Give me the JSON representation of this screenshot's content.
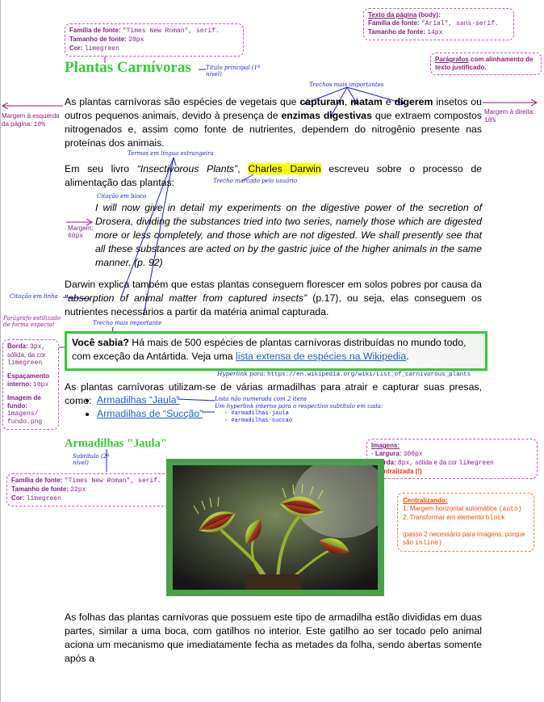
{
  "annotations": {
    "title_font": {
      "family_label": "Família de fonte:",
      "family_value": "\"Times New Roman\", serif.",
      "size_label": "Tamanho de fonte:",
      "size_value": "28px",
      "color_label": "Cor:",
      "color_value": "limegreen"
    },
    "page_text": {
      "heading": "Texto da página",
      "heading_suffix": "(body):",
      "family_label": "Família de fonte:",
      "family_value": "\"Arial\", sans-serif.",
      "size_label": "Tamanho de fonte:",
      "size_value": "14px"
    },
    "paragraphs": {
      "keyword": "Parágrafos",
      "text": "com alinhamento de texto justificado."
    },
    "margin_left": {
      "label": "Margem à esquerda da página:",
      "value": "10%"
    },
    "margin_right": {
      "label": "Margem à direita:",
      "value": "10%"
    },
    "title_main_hand": "Título principal (1º nível)",
    "important_hand": "Trechos mais importantes",
    "foreign_hand": "Termos em língua estrangeira",
    "user_marked_hand": "Trecho marcado pelo usuário",
    "blockquote_hand": "Citação em bloco",
    "margin_quote": {
      "label": "Margem:",
      "value": "60px"
    },
    "inline_quote_hand": "Citação em linha",
    "important_hand_2": "Trecho mais importante",
    "styled_para_hand": "Parágrafo estilizado de forma especial",
    "styled_box": {
      "border_label": "Borda:",
      "border_value": "3px,",
      "border_desc": "sólida, da cor",
      "border_color": "limegreen",
      "padding_label": "Espaçamento interno:",
      "padding_value": "10px",
      "bg_label": "Imagem de fundo:",
      "bg_value": "imagens/ fundo.png"
    },
    "hyperlink_note": {
      "label": "Hyperlink para:",
      "url": "https://en.wikipedia.org/wiki/List_of_carnivorous_plants"
    },
    "list_note": {
      "line1": "Lista não numerada com 2 itens",
      "line2": "Um hyperlink interno para o respectivo subtítulo em cada:",
      "item1": "- #armadilhas-jaula",
      "item2": "- #armadilhas-succao"
    },
    "subtitle_hand": "Subtítulo (2º nível)",
    "subtitle_font": {
      "family_label": "Família de fonte:",
      "family_value": "\"Times New Roman\", serif.",
      "size_label": "Tamanho de fonte:",
      "size_value": "22px",
      "color_label": "Cor:",
      "color_value": "limegreen"
    },
    "images": {
      "heading": "Imagens:",
      "width_label": "Largura:",
      "width_value": "300px",
      "border_label": "Borda:",
      "border_value": "8px,",
      "border_desc": "sólida e da cor",
      "border_color": "limegreen",
      "center_label": "Centralizada (!)"
    },
    "centering": {
      "heading": "Centralizando:",
      "step1": "1. Margem horizontal automática",
      "step1_code": "(auto)",
      "step2": "2. Transformar em elemento",
      "step2_code": "block",
      "note": "(passo 2 necessário para imagens, porque são",
      "note_code": "inline)"
    }
  },
  "document": {
    "title": "Plantas Carnívoras",
    "p1_a": "As plantas carnívoras são espécies de vegetais que ",
    "p1_b1": "capturam",
    "p1_c1": ", ",
    "p1_b2": "matam",
    "p1_c2": " e ",
    "p1_b3": "digerem",
    "p1_d": " insetos ou outros pequenos animais, devido à presença de ",
    "p1_b4": "enzimas digestivas",
    "p1_e": " que extraem compostos nitrogenados e, assim como fonte de nutrientes, dependem do nitrogênio presente nas proteínas dos animais.",
    "p2_a": "Em seu livro ",
    "p2_book": "“Insectivorous Plants”",
    "p2_b": ", ",
    "p2_author": "Charles Darwin",
    "p2_c": " escreveu sobre o processo de alimentação das plantas:",
    "quote": "I will now give in detail my experiments on the digestive power of the secretion of Drosera, dividing the substances tried into two series, namely those which are digested more or less completely, and those which are not digested. We shall presently see that all these substances are acted on by the gastric juice of the higher animals in the same manner. (p. 92)",
    "p3_a": "Darwin explica também que estas plantas conseguem florescer em solos pobres por causa da ",
    "p3_quote": "“absorption of animal matter from captured insects”",
    "p3_b": " (p.17), ou seja, elas conseguem os nutrientes necessários a partir da matéria animal capturada.",
    "fact_strong": "Você sabia?",
    "fact_a": " Há mais de 500 espécies de plantas carnívoras distribuídas no mundo todo, com exceção da Antártida. Veja uma ",
    "fact_link": "lista extensa de espécies na Wikipedia",
    "fact_b": ".",
    "p4": "As plantas carnívoras utilizam-se de várias armadilhas para atrair e capturar suas presas, como:",
    "list": [
      "Armadilhas “Jaula”",
      "Armadilhas de “Sucção”"
    ],
    "subtitle": "Armadilhas \"Jaula\"",
    "p5": "As folhas das plantas carnívoras que possuem este tipo de armadilha estão divididas em duas partes, similar a uma boca, com gatilhos no interior. Este gatilho ao ser tocado pelo animal aciona um mecanismo que imediatamente fecha as metades da folha, sendo abertas somente após a"
  },
  "colors": {
    "limegreen": "#32cd32",
    "annotation_purple": "#8a1c8a",
    "annotation_blue": "#1a1adf",
    "annotation_orange": "#ff4400",
    "highlight": "#ffff00",
    "link": "#1a5fd1"
  }
}
